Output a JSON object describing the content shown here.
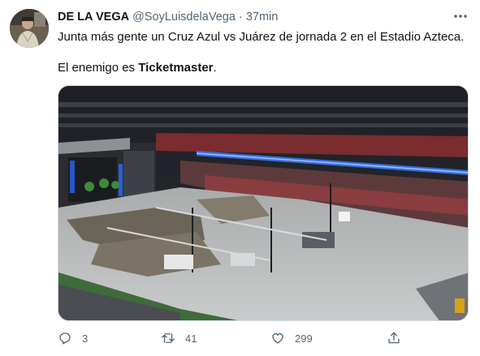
{
  "tweet": {
    "display_name": "DE LA VEGA",
    "handle": "@SoyLuisdelaVega",
    "separator": "·",
    "time": "37min",
    "text_line1": "Junta más gente un Cruz Azul vs Juárez de jornada 2 en el Estadio Azteca.",
    "text_line2_prefix": "El enemigo es ",
    "text_line2_bold": "Ticketmaster",
    "text_line2_suffix": ".",
    "image": {
      "description": "photo of a stadium with a concert stage and crowd on the field"
    }
  },
  "actions": {
    "replies": "3",
    "retweets": "41",
    "likes": "299"
  },
  "icons": {
    "more": "more-icon",
    "reply": "reply-icon",
    "retweet": "retweet-icon",
    "like": "heart-icon",
    "share": "share-icon"
  },
  "colors": {
    "text": "#0f1419",
    "secondary": "#536471",
    "border": "#cfd9de"
  }
}
